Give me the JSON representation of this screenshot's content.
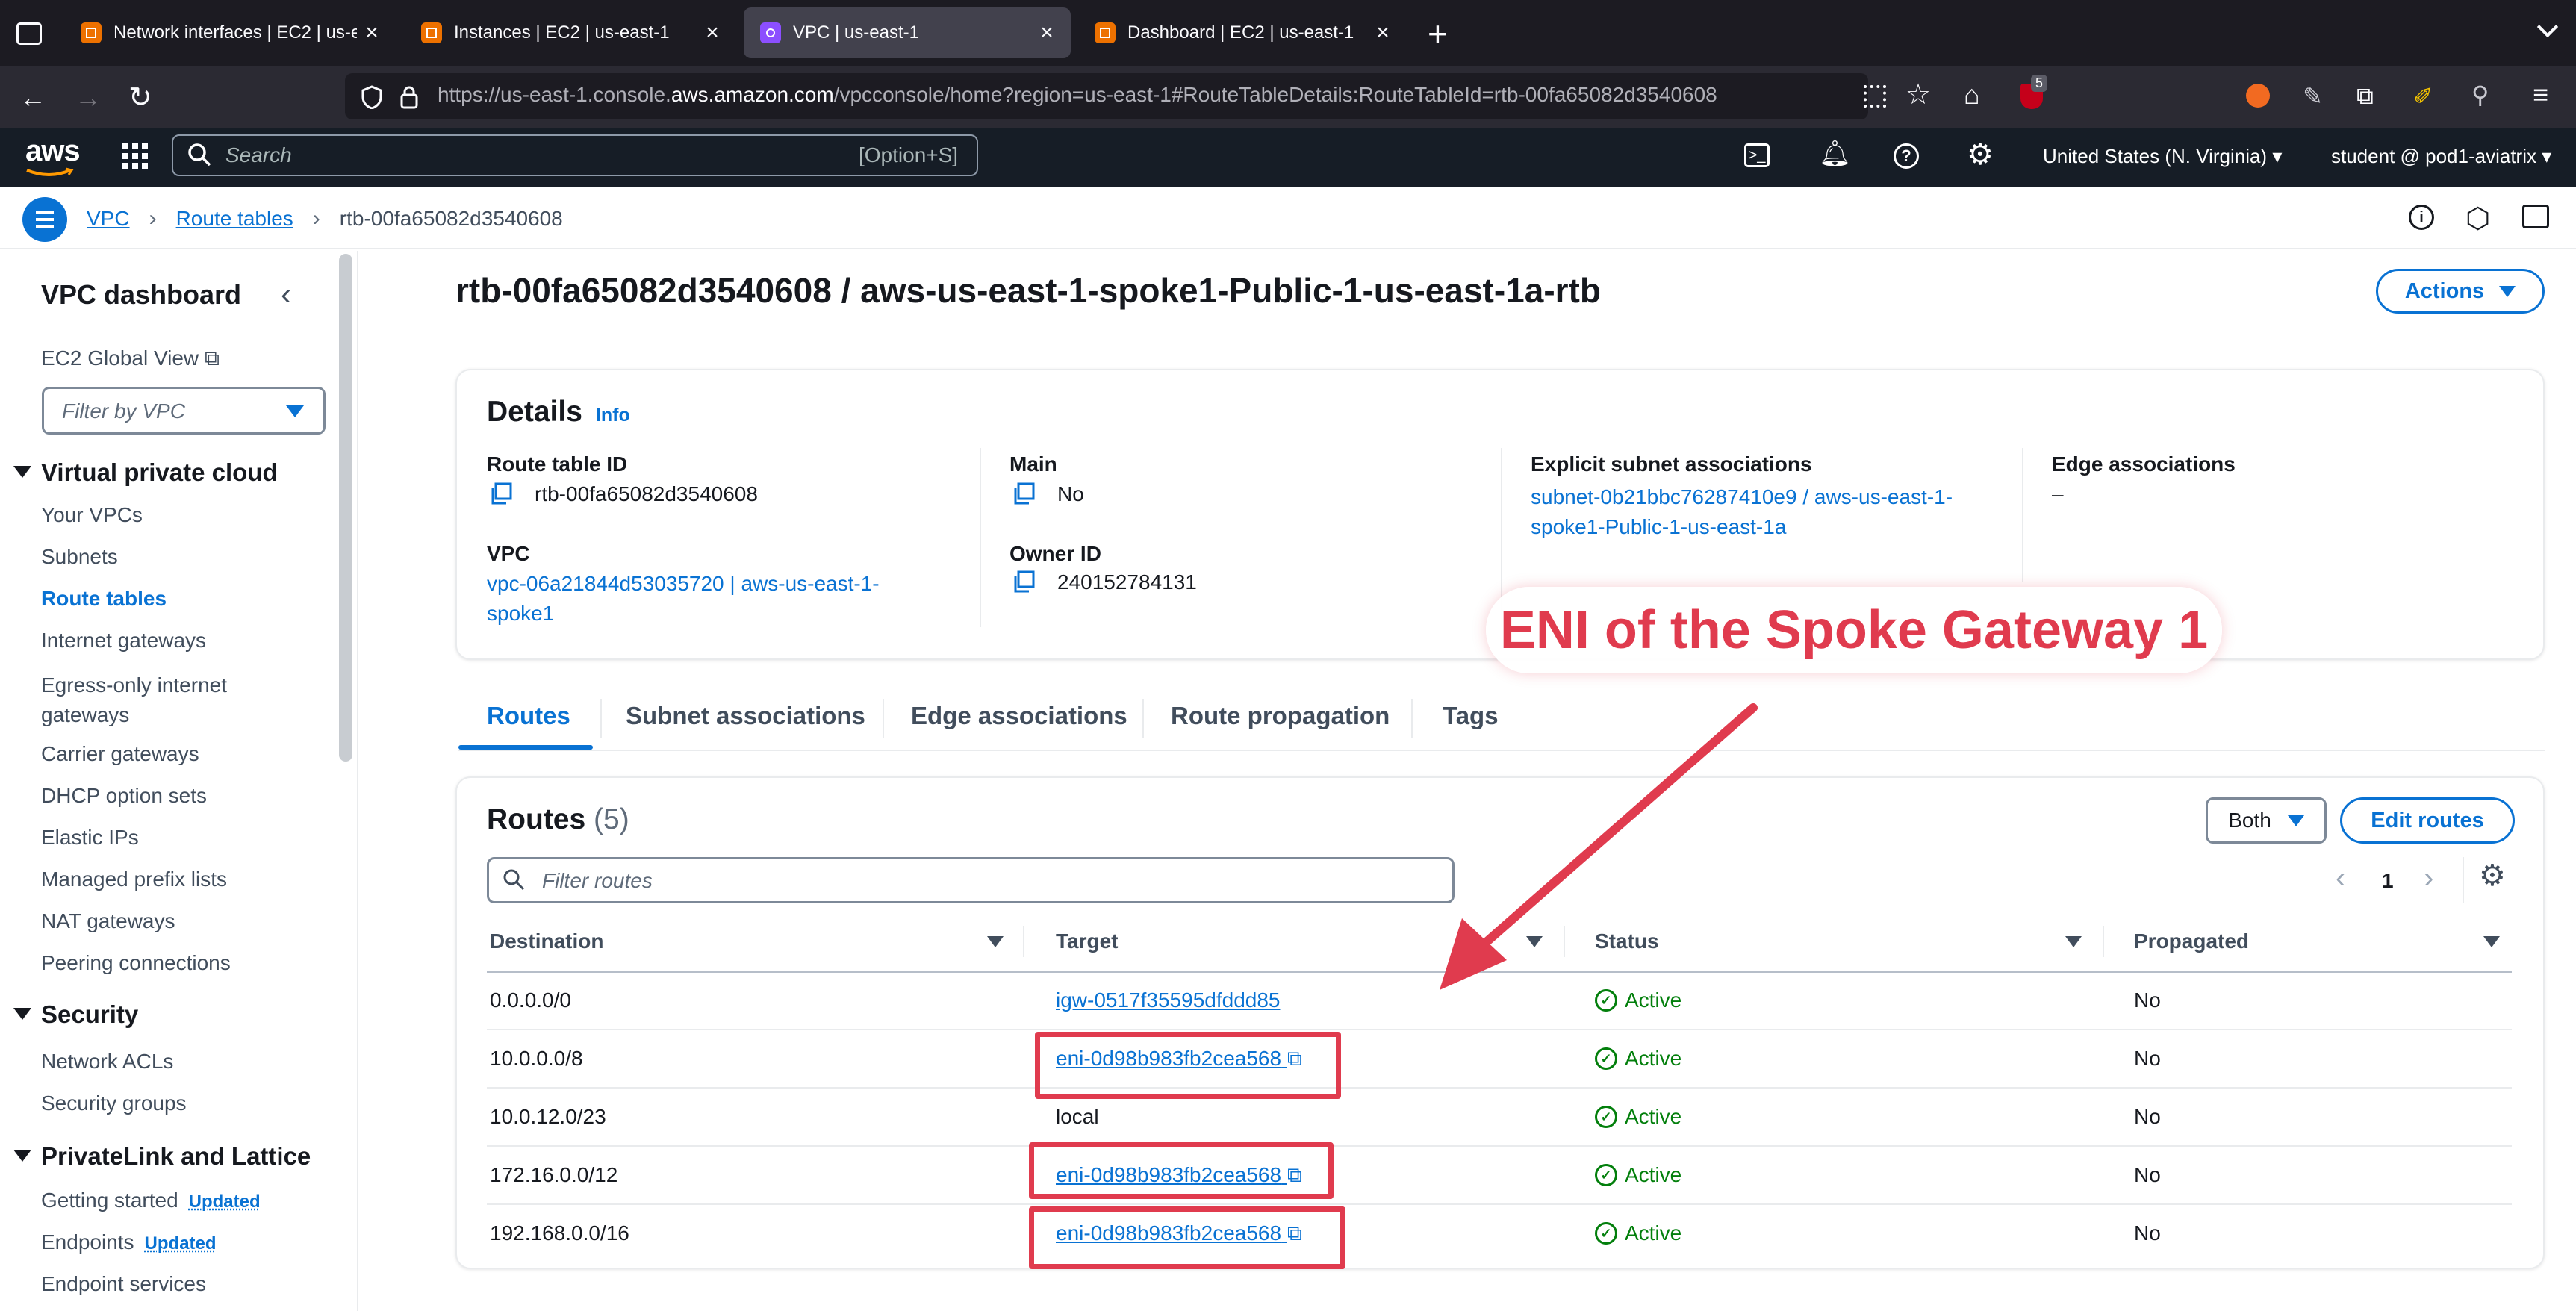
{
  "browser": {
    "tabs": [
      {
        "title": "Network interfaces | EC2 | us-ea",
        "active": false
      },
      {
        "title": "Instances | EC2 | us-east-1",
        "active": false
      },
      {
        "title": "VPC | us-east-1",
        "active": true
      },
      {
        "title": "Dashboard | EC2 | us-east-1",
        "active": false
      }
    ],
    "url_prefix": "https://us-east-1.console.",
    "url_domain": "aws.amazon.com",
    "url_suffix": "/vpcconsole/home?region=us-east-1#RouteTableDetails:RouteTableId=rtb-00fa65082d3540608",
    "extension_badge": "5"
  },
  "aws_header": {
    "search_placeholder": "Search",
    "search_shortcut": "[Option+S]",
    "region": "United States (N. Virginia)",
    "user": "student @ pod1-aviatrix"
  },
  "breadcrumb": {
    "items": [
      "VPC",
      "Route tables"
    ],
    "current": "rtb-00fa65082d3540608"
  },
  "sidebar": {
    "title": "VPC dashboard",
    "global_view": "EC2 Global View",
    "filter_placeholder": "Filter by VPC",
    "sections": [
      {
        "title": "Virtual private cloud",
        "items": [
          "Your VPCs",
          "Subnets",
          "Route tables",
          "Internet gateways",
          "Egress-only internet gateways",
          "Carrier gateways",
          "DHCP option sets",
          "Elastic IPs",
          "Managed prefix lists",
          "NAT gateways",
          "Peering connections"
        ]
      },
      {
        "title": "Security",
        "items": [
          "Network ACLs",
          "Security groups"
        ]
      },
      {
        "title": "PrivateLink and Lattice",
        "items": [
          "Getting started",
          "Endpoints",
          "Endpoint services"
        ]
      }
    ],
    "egress_line1": "Egress-only internet",
    "egress_line2": "gateways",
    "updated_label": "Updated",
    "active_item": "Route tables"
  },
  "page": {
    "title": "rtb-00fa65082d3540608 / aws-us-east-1-spoke1-Public-1-us-east-1a-rtb",
    "actions_label": "Actions"
  },
  "details": {
    "heading": "Details",
    "info": "Info",
    "route_table_id_label": "Route table ID",
    "route_table_id": "rtb-00fa65082d3540608",
    "main_label": "Main",
    "main_value": "No",
    "explicit_label": "Explicit subnet associations",
    "explicit_line1": "subnet-0b21bbc76287410e9 / aws-us-east-1-",
    "explicit_line2": "spoke1-Public-1-us-east-1a",
    "edge_label": "Edge associations",
    "edge_value": "–",
    "vpc_label": "VPC",
    "vpc_line1": "vpc-06a21844d53035720 | aws-us-east-1-",
    "vpc_line2": "spoke1",
    "owner_label": "Owner ID",
    "owner_value": "240152784131"
  },
  "annotation": {
    "callout": "ENI of the Spoke Gateway 1",
    "color": "#e03b4e"
  },
  "tabs": [
    "Routes",
    "Subnet associations",
    "Edge associations",
    "Route propagation",
    "Tags"
  ],
  "routes": {
    "heading": "Routes",
    "count": "(5)",
    "filter_label": "Both",
    "edit_label": "Edit routes",
    "filter_placeholder": "Filter routes",
    "page": "1",
    "columns": [
      "Destination",
      "Target",
      "Status",
      "Propagated"
    ],
    "rows": [
      {
        "destination": "0.0.0.0/0",
        "target": "igw-0517f35595dfddd85",
        "status": "Active",
        "propagated": "No"
      },
      {
        "destination": "10.0.0.0/8",
        "target": "eni-0d98b983fb2cea568",
        "status": "Active",
        "propagated": "No"
      },
      {
        "destination": "10.0.12.0/23",
        "target": "local",
        "status": "Active",
        "propagated": "No"
      },
      {
        "destination": "172.16.0.0/12",
        "target": "eni-0d98b983fb2cea568",
        "status": "Active",
        "propagated": "No"
      },
      {
        "destination": "192.168.0.0/16",
        "target": "eni-0d98b983fb2cea568",
        "status": "Active",
        "propagated": "No"
      }
    ]
  }
}
